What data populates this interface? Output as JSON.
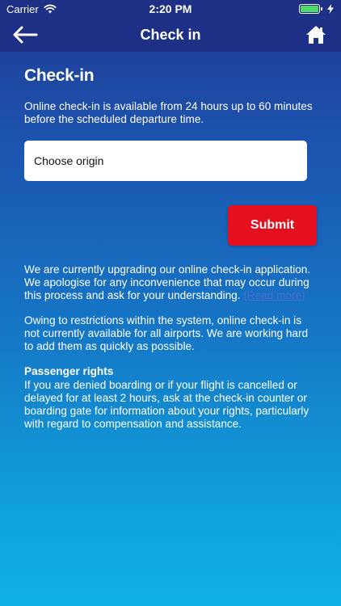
{
  "status_bar": {
    "carrier": "Carrier",
    "time": "2:20 PM",
    "icons": [
      "wifi-icon",
      "battery-icon",
      "charging-icon"
    ],
    "battery_level": 1.0
  },
  "nav": {
    "title": "Check in",
    "back_icon": "back-arrow-icon",
    "home_icon": "home-icon"
  },
  "main": {
    "heading": "Check-in",
    "intro": "Online check-in is available from 24 hours up to 60 minutes before the scheduled departure time.",
    "origin_placeholder": "Choose origin",
    "submit_label": "Submit",
    "upgrade_notice": "We are currently upgrading our online check-in application. We apologise for any inconvenience that may occur during this process and ask for your understanding.",
    "read_more": "(Read more)",
    "restrictions_notice": "Owing to restrictions within the system, online check-in is not currently available for all airports. We are working hard to add them as quickly as possible.",
    "rights_heading": "Passenger rights",
    "rights_text": "If you are denied boarding or if your flight is cancelled or delayed for at least 2 hours, ask at the check-in counter or boarding gate for information about your rights, particularly with regard to compensation and assistance."
  },
  "colors": {
    "header": "#1e2f86",
    "submit": "#e4101d",
    "link": "#4a6fd1",
    "battery": "#4cd964"
  }
}
